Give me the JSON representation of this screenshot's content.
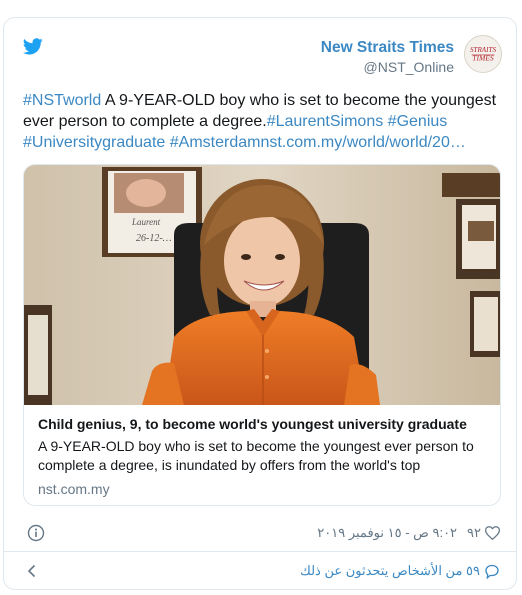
{
  "author": {
    "name": "New Straits Times",
    "handle": "@NST_Online",
    "avatar_logo_text": "STRAITS TIMES"
  },
  "tweet": {
    "segments": [
      {
        "text": "#NSTworld",
        "link": true
      },
      {
        "text": " A 9-YEAR-OLD boy who is set to become the youngest ever person to complete a degree.",
        "link": false
      },
      {
        "text": "#LaurentSimons",
        "link": true
      },
      {
        "text": " ",
        "link": false
      },
      {
        "text": "#Genius",
        "link": true
      },
      {
        "text": " ",
        "link": false
      },
      {
        "text": "#Universitygraduate",
        "link": true
      },
      {
        "text": " ",
        "link": false
      },
      {
        "text": "#Amsterdam",
        "link": true
      },
      {
        "text": "nst.com.my/world/world/20…",
        "link": true
      }
    ]
  },
  "card": {
    "photo_caption_text": "Laurent",
    "photo_date_text": "26-12-…",
    "title": "Child genius, 9, to become world's youngest university graduate",
    "description": "A 9-YEAR-OLD boy who is set to become the youngest ever person to complete a degree, is inundated by offers from the world's top",
    "domain": "nst.com.my"
  },
  "footer": {
    "likes": "٩٢",
    "timestamp": "٩:٠٢ ص - ١٥ نوفمبر ٢٠١٩",
    "conversation": "٥٩ من الأشخاص يتحدثون عن ذلك"
  },
  "icons": {
    "bird": "twitter-bird-icon",
    "info": "info-icon",
    "heart": "heart-icon",
    "chevron": "chevron-left-icon",
    "bubble": "comment-bubble-icon"
  },
  "colors": {
    "brand_blue": "#1da1f2",
    "link_blue": "#3b88c3",
    "secondary_text": "#657786",
    "border": "#e1e8ed",
    "shirt_orange": "#e8731f"
  }
}
